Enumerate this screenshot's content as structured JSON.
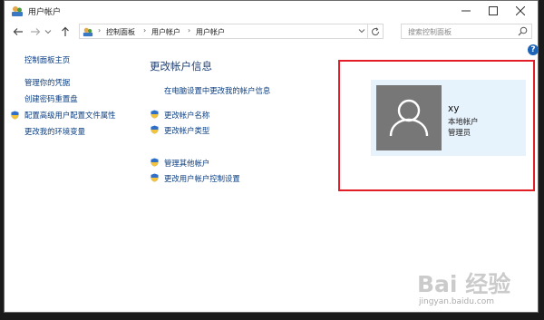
{
  "window": {
    "title": "用户帐户",
    "minimize_icon": "minimize-icon",
    "maximize_icon": "maximize-icon",
    "close_icon": "close-icon"
  },
  "nav": {
    "back_icon": "back-arrow-icon",
    "forward_icon": "forward-arrow-icon",
    "recent_icon": "chevron-down-icon",
    "up_icon": "up-arrow-icon",
    "breadcrumb": [
      "控制面板",
      "用户帐户",
      "用户帐户"
    ],
    "refresh_icon": "refresh-icon",
    "search_placeholder": "搜索控制面板"
  },
  "sidebar": {
    "items": [
      {
        "label": "控制面板主页",
        "shield": false
      },
      {
        "label": "管理你的凭据",
        "shield": false
      },
      {
        "label": "创建密码重置盘",
        "shield": false
      },
      {
        "label": "配置高级用户配置文件属性",
        "shield": true
      },
      {
        "label": "更改我的环境变量",
        "shield": false
      }
    ]
  },
  "main": {
    "heading": "更改帐户信息",
    "links": [
      {
        "label": "在电脑设置中更改我的帐户信息",
        "shield": false
      },
      {
        "label": "更改帐户名称",
        "shield": true
      },
      {
        "label": "更改帐户类型",
        "shield": true
      },
      {
        "label": "管理其他帐户",
        "shield": true
      },
      {
        "label": "更改用户帐户控制设置",
        "shield": true
      }
    ]
  },
  "user": {
    "name": "xy",
    "type_lines": [
      "本地帐户",
      "管理员"
    ],
    "avatar_icon": "user-avatar-icon"
  },
  "watermark": {
    "text": "Bai 经验",
    "url": "jingyan.baidu.com"
  },
  "colors": {
    "link": "#0b3e82",
    "heading": "#1e3f73",
    "highlight": "#e21d27",
    "card": "#e6f2fc"
  }
}
